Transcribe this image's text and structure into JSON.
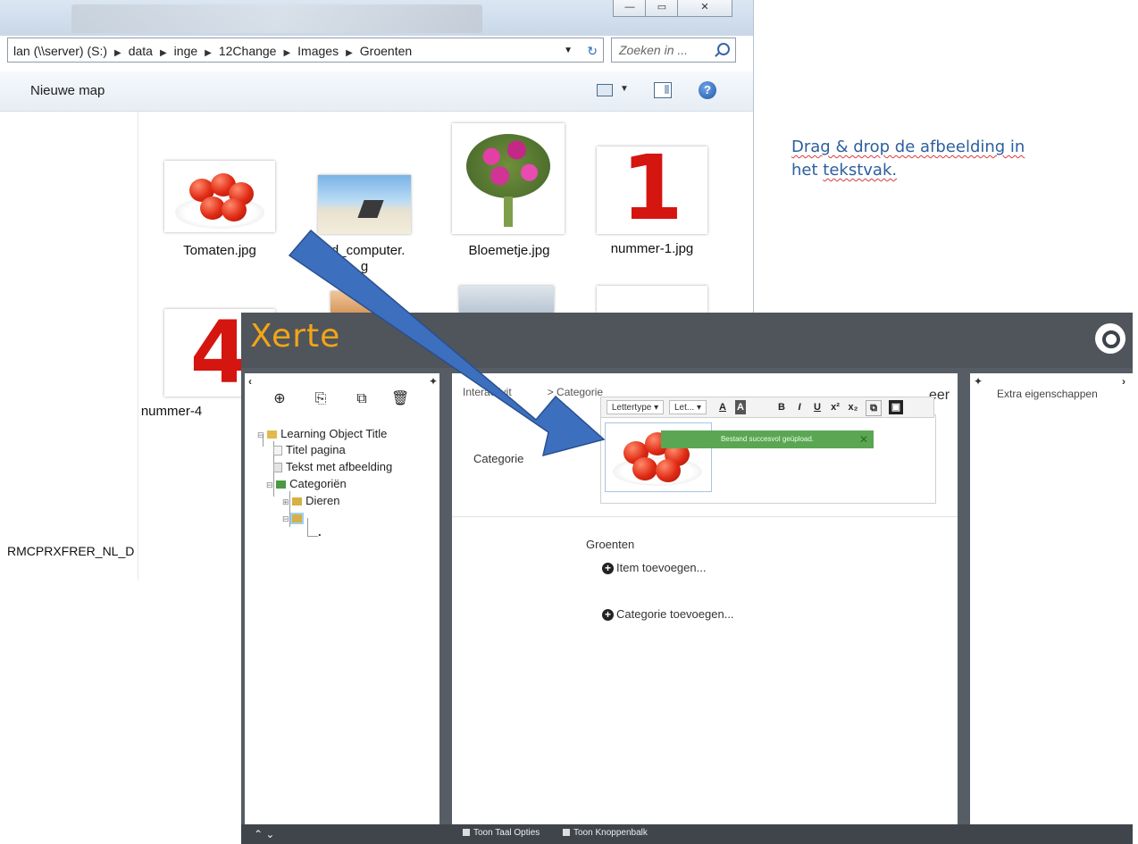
{
  "explorer": {
    "address": [
      "lan (\\\\server) (S:)",
      "data",
      "inge",
      "12Change",
      "Images",
      "Groenten"
    ],
    "search_placeholder": "Zoeken in ...",
    "toolbar": {
      "new_folder": "Nieuwe map"
    },
    "nav_item": "RMCPRXFRER_NL_D",
    "files": [
      {
        "name": "Tomaten.jpg"
      },
      {
        "name": "ad_computer."
      },
      {
        "name": "Bloemetje.jpg"
      },
      {
        "name": "nummer-1.jpg"
      },
      {
        "name": "nummer-4"
      }
    ],
    "file2_sub": "g",
    "digits": {
      "one": "1",
      "four": "4"
    }
  },
  "instruction": {
    "line1": "Drag & drop de afbeelding in",
    "line2a": "het",
    "line2b": "tekstvak."
  },
  "xerte": {
    "logo": "Xerte",
    "tree": {
      "root": "Learning Object Title",
      "items": [
        "Titel pagina",
        "Tekst met afbeelding",
        "Categoriën",
        "Dieren"
      ],
      "dot": "."
    },
    "breadcrumb": {
      "left": "Interactivit",
      "right": "> Categorie"
    },
    "publish": "eer",
    "toolbar": {
      "font": "Lettertype",
      "size": "Let..."
    },
    "success": "Bestand succesvol geüpload.",
    "category_label": "Categorie",
    "group_label": "Groenten",
    "add_item": "Item toevoegen...",
    "add_category": "Categorie toevoegen...",
    "extra_properties": "Extra eigenschappen",
    "bottom": {
      "lang": "Toon Taal Opties",
      "buttons": "Toon Knoppenbalk"
    }
  },
  "colors": {
    "xerte_header": "#4f555b",
    "xerte_orange": "#f2a516",
    "arrow": "#3d6fbf",
    "success": "#5aa653"
  }
}
